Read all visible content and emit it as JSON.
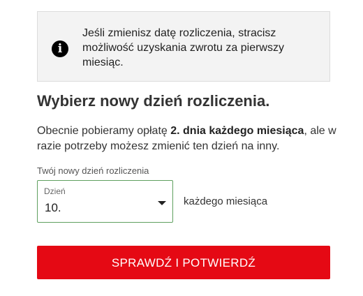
{
  "notice": {
    "icon": "info-icon",
    "icon_glyph": "i",
    "text": "Jeśli zmienisz datę rozliczenia, stracisz możliwość uzyskania zwrotu za pierwszy miesiąc."
  },
  "heading": "Wybierz nowy dzień rozliczenia.",
  "description": {
    "before": "Obecnie pobieramy opłatę ",
    "bold": "2. dnia każdego miesiąca",
    "after": ", ale w razie potrzeby możesz zmienić ten dzień na inny."
  },
  "billing_day": {
    "label": "Twój nowy dzień rozliczenia",
    "select_caption": "Dzień",
    "selected_value": "10.",
    "suffix": "każdego miesiąca"
  },
  "confirm_button": {
    "label": "SPRAWDŹ I POTWIERDŹ",
    "color": "#e50914"
  },
  "colors": {
    "notice_background": "#f3f3f3",
    "select_border": "#5fa05f"
  }
}
